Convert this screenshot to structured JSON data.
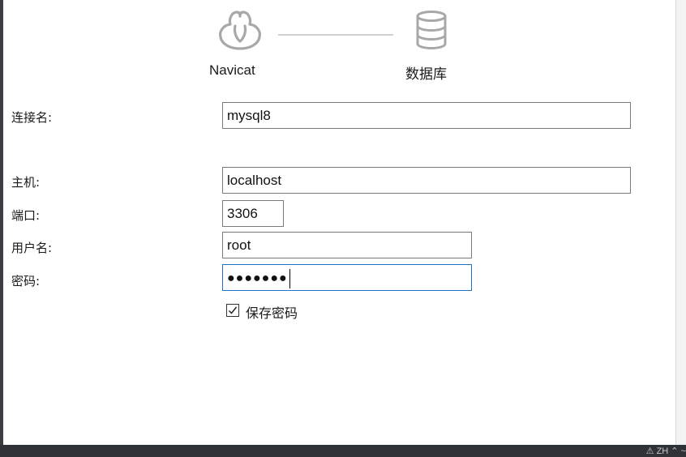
{
  "steps": [
    {
      "label": "Navicat",
      "icon": "navicat-logo-icon"
    },
    {
      "label": "数据库",
      "icon": "database-icon"
    }
  ],
  "form": {
    "connection_name": {
      "label": "连接名:",
      "value": "mysql8"
    },
    "host": {
      "label": "主机:",
      "value": "localhost"
    },
    "port": {
      "label": "端口:",
      "value": "3306"
    },
    "username": {
      "label": "用户名:",
      "value": "root"
    },
    "password": {
      "label": "密码:",
      "value": "●●●●●●●"
    },
    "save_password": {
      "label": "保存密码",
      "checked": true
    }
  },
  "bottom_bar": {
    "text": "⚠ ZH ⌃ ~"
  },
  "colors": {
    "focus_border": "#1e72c8",
    "input_border": "#7a7a7a",
    "icon_gray": "#a8a8a8",
    "background": "#ffffff"
  }
}
